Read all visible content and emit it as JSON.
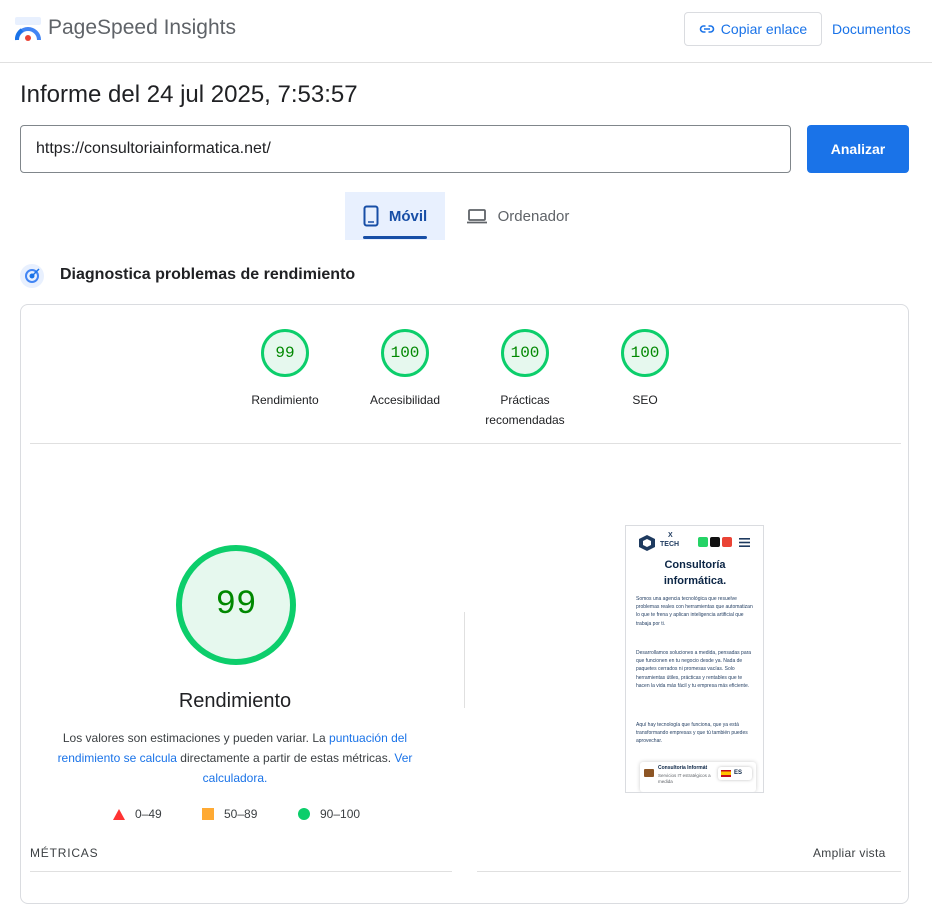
{
  "header": {
    "app_title": "PageSpeed Insights",
    "copy_link_label": "Copiar enlace",
    "docs_label": "Documentos"
  },
  "report": {
    "title": "Informe del 24 jul 2025, 7:53:57",
    "url_value": "https://consultoriainformatica.net/",
    "analyze_label": "Analizar"
  },
  "tabs": [
    {
      "label": "Móvil",
      "active": true
    },
    {
      "label": "Ordenador",
      "active": false
    }
  ],
  "diagnostic": {
    "label": "Diagnostica problemas de rendimiento"
  },
  "scores": [
    {
      "value": "99",
      "label": "Rendimiento"
    },
    {
      "value": "100",
      "label": "Accesibilidad"
    },
    {
      "value": "100",
      "label": "Prácticas recomendadas"
    },
    {
      "value": "100",
      "label": "SEO"
    }
  ],
  "performance": {
    "score": "99",
    "label": "Rendimiento",
    "desc_part1": "Los valores son estimaciones y pueden variar. La ",
    "desc_link1": "puntuación del rendimiento se calcula",
    "desc_part2": " directamente a partir de estas métricas. ",
    "desc_link2": "Ver calculadora."
  },
  "legend": [
    {
      "label": "0–49",
      "color": "#ff3333",
      "shape": "triangle"
    },
    {
      "label": "50–89",
      "color": "#ffaa33",
      "shape": "square"
    },
    {
      "label": "90–100",
      "color": "#0cce6b",
      "shape": "circle"
    }
  ],
  "metrics": {
    "title": "MÉTRICAS",
    "expand_label": "Ampliar vista"
  },
  "screenshot": {
    "brand_x": "X",
    "brand_tech": "TECH",
    "headline": "Consultoría informática.",
    "p1": "Somos una agencia tecnológica que resuelve problemas reales con herramientas que automatizan lo que te frena y aplican inteligencia artificial que trabaja por ti.",
    "p2": "Desarrollamos soluciones a medida, pensadas para que funcionen en tu negocio desde ya. Nada de paquetes cerrados ni promesas vacías. Solo herramientas útiles, prácticas y rentables que te hacen la vida más fácil y tu empresa más eficiente.",
    "p3": "Aquí hay tecnología que funciona, que ya está transformando empresas y que tú también puedes aprovechar.",
    "chip_title": "Consultoría Informát",
    "chip_sub": "Servicios IT estratégicos a medida",
    "lang": "ES"
  },
  "colors": {
    "accent": "#1a73e8",
    "pass_green": "#0cce6b",
    "pass_text": "#008800"
  }
}
